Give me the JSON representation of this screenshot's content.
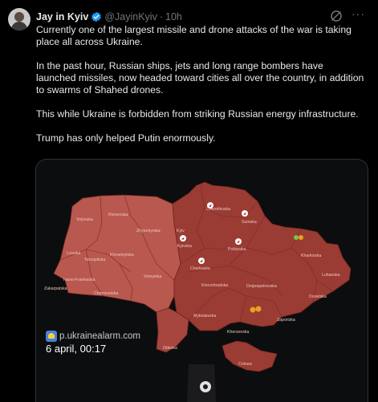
{
  "author": {
    "name": "Jay in Kyiv",
    "handle": "@JayinKyiv",
    "separator": "·",
    "time": "10h"
  },
  "tweet": {
    "paragraphs": [
      "Currently one of the largest missile and drone attacks of the war is taking place all across Ukraine.",
      "In the past hour, Russian ships, jets and long range bombers have launched missiles, now headed toward cities all over the country, in addition to swarms of Shahed drones.",
      "This while Ukraine is forbidden from striking Russian energy infrastructure.",
      "Trump has only helped Putin enormously."
    ]
  },
  "icons": {
    "verified": "verified-badge-icon",
    "grok": "grok-icon",
    "more": "more-options-icon",
    "missile": "missile-marker-icon",
    "drone": "drone-marker-icon"
  },
  "colors": {
    "background": "#000000",
    "text": "#e7e9ea",
    "muted": "#71767b",
    "verified": "#1d9bf0",
    "map_west": "#b8584e",
    "map_east": "#9a3b34",
    "map_border": "#6f241f"
  },
  "map": {
    "watermark_url": "p.ukrainealarm.com",
    "date": "6 april, 00:17",
    "regions": {
      "volynska": "Volynska",
      "rivnenska": "Rivnenska",
      "zhytomyrska": "Zhytomyrska",
      "kyiv": "Kyiv",
      "kyivska": "Kyivska",
      "chernihivska": "Chernihivska",
      "sumska": "Sumska",
      "lvivska": "Lvivska",
      "ternopilska": "Ternopilska",
      "khmelnytska": "Khmelnytska",
      "vinnytska": "Vinnytska",
      "cherkaska": "Cherkaska",
      "poltavska": "Poltavska",
      "kharkivska": "Kharkivska",
      "ivano_frankivska": "Ivano-Frankivska",
      "chernivetska": "Chernivetska",
      "zakarpatska": "Zakarpatska",
      "kirovohradska": "Kirovohradska",
      "dnipropetrovska": "Dnipropetrovska",
      "luhanska": "Luhanska",
      "donetska": "Donetska",
      "mykolaivska": "Mykolaivska",
      "zaporizka": "Zaporizka",
      "khersonska": "Khersonska",
      "odeska": "Odeska",
      "crimea": "Crimea"
    }
  }
}
